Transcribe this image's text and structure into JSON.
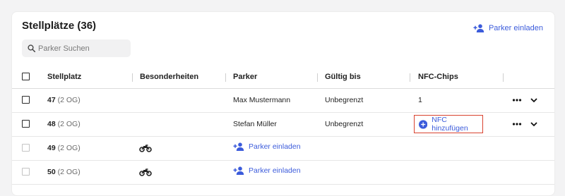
{
  "header": {
    "title": "Stellplätze (36)",
    "invite_label": "Parker einladen"
  },
  "search": {
    "placeholder": "Parker Suchen",
    "value": ""
  },
  "table": {
    "columns": [
      "Stellplatz",
      "Besonderheiten",
      "Parker",
      "Gültig bis",
      "NFC-Chips"
    ],
    "rows": [
      {
        "number": "47",
        "floor": "(2 OG)",
        "feature": "",
        "parker": "Max Mustermann",
        "valid_until": "Unbegrenzt",
        "nfc": "1"
      },
      {
        "number": "48",
        "floor": "(2 OG)",
        "feature": "",
        "parker": "Stefan Müller",
        "valid_until": "Unbegrenzt",
        "nfc_action": "NFC hinzufügen"
      },
      {
        "number": "49",
        "floor": "(2 OG)",
        "feature": "motorcycle-icon",
        "parker_action": "Parker einladen"
      },
      {
        "number": "50",
        "floor": "(2 OG)",
        "feature": "motorcycle-icon",
        "parker_action": "Parker einladen"
      }
    ]
  },
  "colors": {
    "accent": "#3b5bdb",
    "highlight": "#d9432f"
  }
}
